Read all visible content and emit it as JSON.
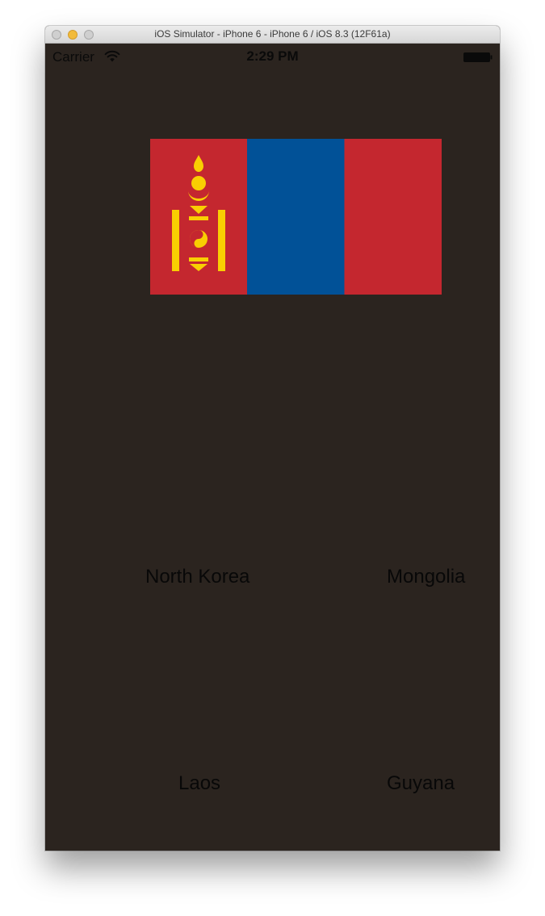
{
  "window": {
    "title": "iOS Simulator - iPhone 6 - iPhone 6 / iOS 8.3 (12F61a)"
  },
  "status_bar": {
    "carrier": "Carrier",
    "wifi_icon": "wifi-icon",
    "time": "2:29 PM",
    "battery_icon": "battery-icon"
  },
  "quiz": {
    "flag": {
      "icon": "mongolia-flag",
      "colors": {
        "red": "#c4272f",
        "blue": "#015197",
        "yellow": "#f9cf02"
      }
    },
    "choices": [
      {
        "label": "North Korea"
      },
      {
        "label": "Mongolia"
      },
      {
        "label": "Laos"
      },
      {
        "label": "Guyana"
      }
    ]
  },
  "colors": {
    "screen_background": "#2b241f",
    "text": "#080808"
  }
}
